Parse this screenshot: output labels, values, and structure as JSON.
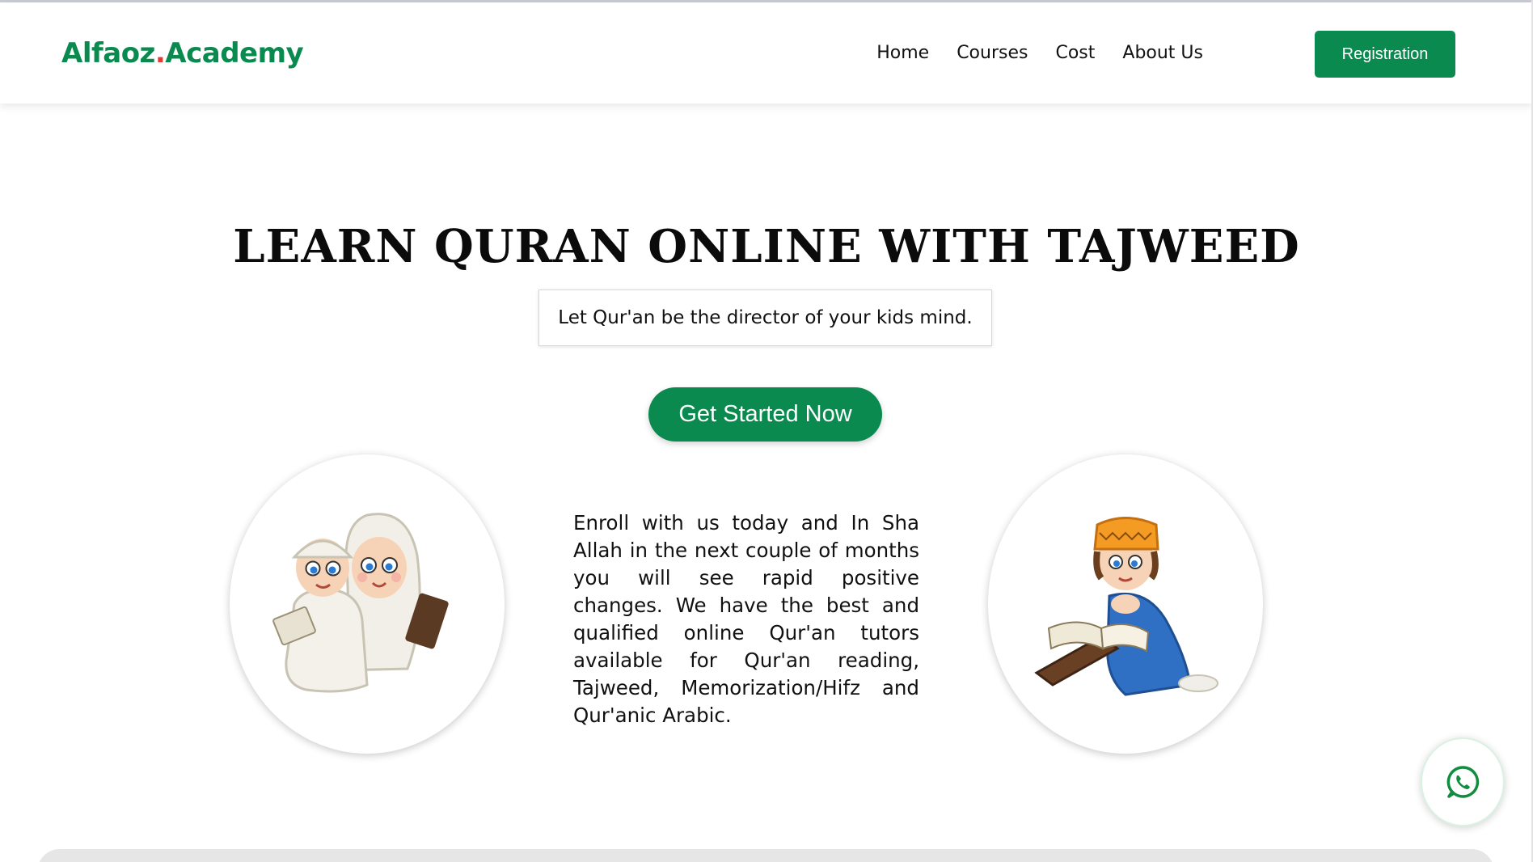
{
  "brand": {
    "name_part1": "Alfaoz",
    "dot": ".",
    "name_part2": "Academy",
    "color": "#0a8a4f"
  },
  "nav": {
    "items": [
      {
        "label": "Home"
      },
      {
        "label": "Courses"
      },
      {
        "label": "Cost"
      },
      {
        "label": "About Us"
      }
    ],
    "registration_label": "Registration"
  },
  "hero": {
    "title": "LEARN QURAN ONLINE WITH TAJWEED",
    "tagline": "Let Qur'an be the director of your kids mind.",
    "cta_label": "Get Started Now",
    "description": "Enroll with us today and In Sha Allah in the next couple of months you will see rapid positive changes. We have the best and qualified online Qur'an tutors available for Qur'an reading, Tajweed, Memorization/Hifz and Qur'anic Arabic."
  },
  "images": {
    "left": "illustration-boy-and-girl-reading-quran",
    "right": "illustration-boy-praying-with-quran"
  },
  "floating": {
    "icon": "whatsapp-icon"
  },
  "colors": {
    "accent": "#0a8a4f",
    "text": "#111111",
    "border": "#d8d8d8"
  }
}
